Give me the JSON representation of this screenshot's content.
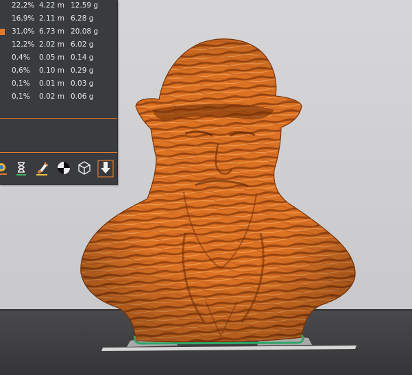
{
  "filament_table": {
    "rows": [
      {
        "percent": "22,2%",
        "length": "4.22 m",
        "weight": "12.59 g",
        "highlighted": false
      },
      {
        "percent": "16,9%",
        "length": "2.11 m",
        "weight": "6.28 g",
        "highlighted": false
      },
      {
        "percent": "31,0%",
        "length": "6.73 m",
        "weight": "20.08 g",
        "highlighted": true
      },
      {
        "percent": "12,2%",
        "length": "2.02 m",
        "weight": "6.02 g",
        "highlighted": false
      },
      {
        "percent": "0,4%",
        "length": "0.05 m",
        "weight": "0.14 g",
        "highlighted": false
      },
      {
        "percent": "0,6%",
        "length": "0.10 m",
        "weight": "0.29 g",
        "highlighted": false
      },
      {
        "percent": "0,1%",
        "length": "0.01 m",
        "weight": "0.03 g",
        "highlighted": false
      },
      {
        "percent": "0,1%",
        "length": "0.02 m",
        "weight": "0.06 g",
        "highlighted": false
      }
    ]
  },
  "toolbar": {
    "icons": [
      "color-print-icon",
      "hourglass-icon",
      "paintbrush-icon",
      "center-of-gravity-icon",
      "cube-wireframe-icon",
      "download-arrow-icon"
    ]
  },
  "colors": {
    "accent": "#e07a2f",
    "panel": "#3a3b3e",
    "model": "#d86d1e",
    "model_dark": "#8a3c0c",
    "bed": "#3e3e40",
    "backdrop": "#d3d3d5"
  }
}
